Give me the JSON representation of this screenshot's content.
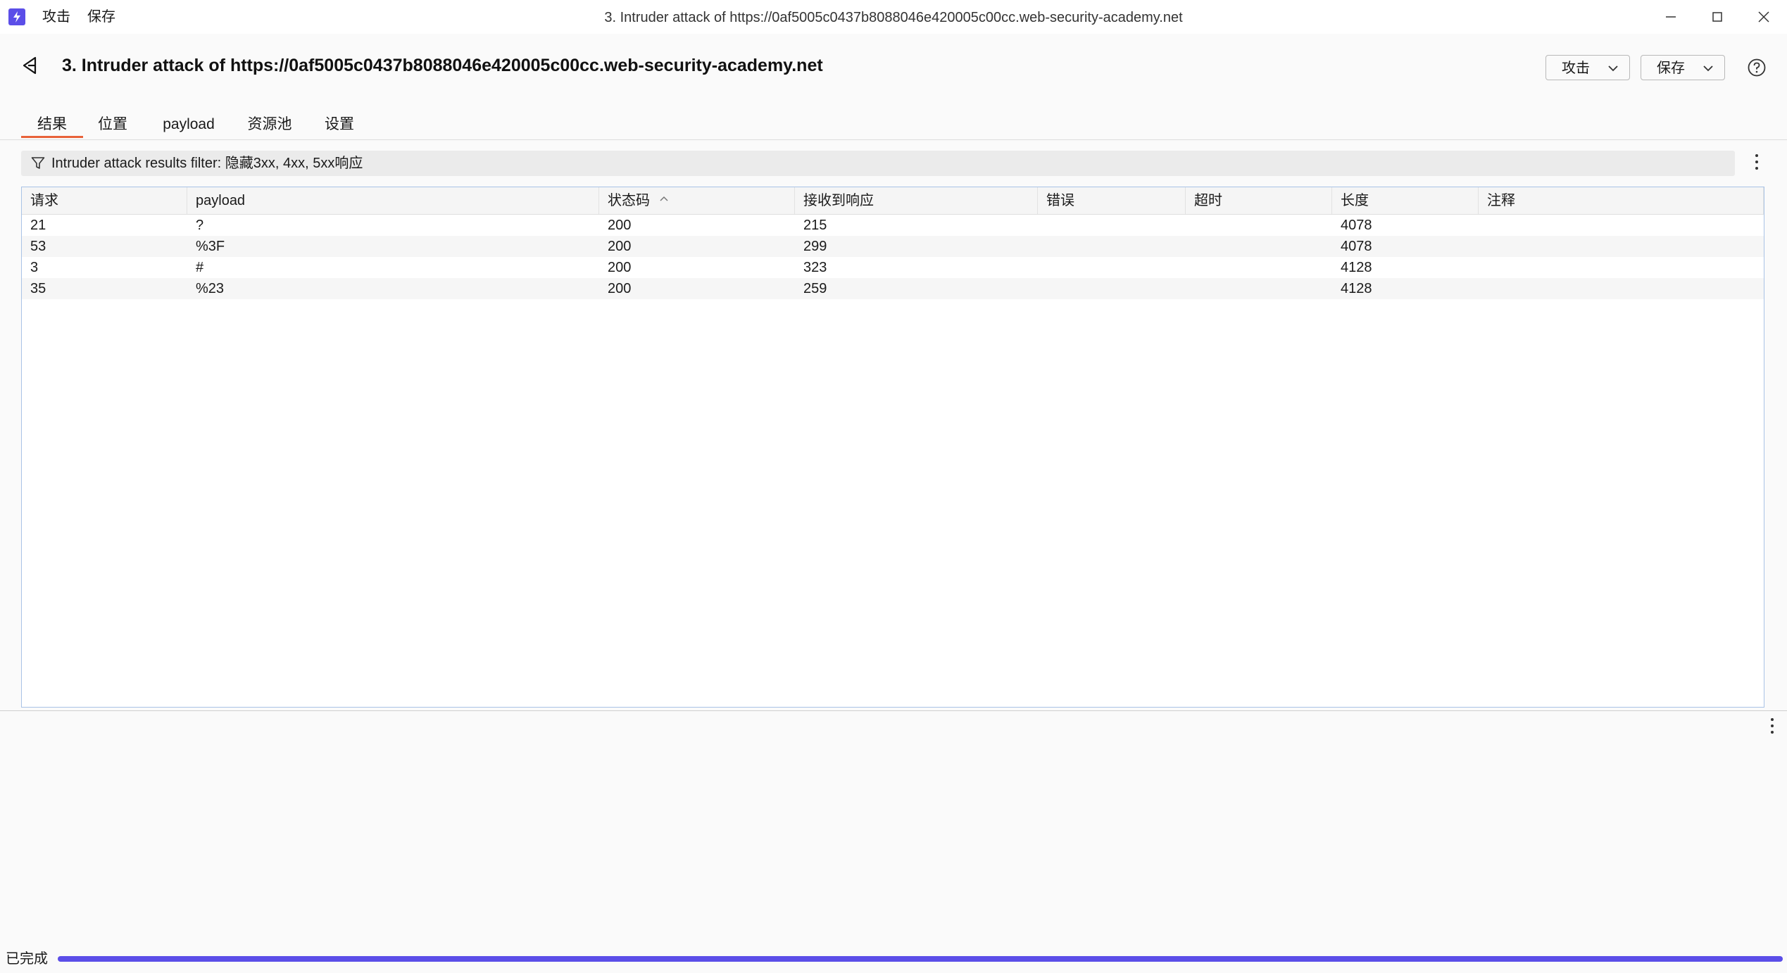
{
  "app": {
    "menu": [
      "攻击",
      "保存"
    ],
    "window_title": "3. Intruder attack of https://0af5005c0437b8088046e420005c00cc.web-security-academy.net"
  },
  "header": {
    "title": "3. Intruder attack of https://0af5005c0437b8088046e420005c00cc.web-security-academy.net",
    "attack_button": "攻击",
    "save_button": "保存"
  },
  "tabs": [
    "结果",
    "位置",
    "payload",
    "资源池",
    "设置"
  ],
  "active_tab": "结果",
  "filter": {
    "text": "Intruder attack results filter: 隐藏3xx, 4xx, 5xx响应"
  },
  "table": {
    "columns": [
      "请求",
      "payload",
      "状态码",
      "接收到响应",
      "错误",
      "超时",
      "长度",
      "注释"
    ],
    "sorted_column": "状态码",
    "sort_direction": "ascending",
    "rows": [
      [
        "21",
        "?",
        "200",
        "215",
        "",
        "",
        "4078",
        ""
      ],
      [
        "53",
        "%3F",
        "200",
        "299",
        "",
        "",
        "4078",
        ""
      ],
      [
        "3",
        "#",
        "200",
        "323",
        "",
        "",
        "4128",
        ""
      ],
      [
        "35",
        "%23",
        "200",
        "259",
        "",
        "",
        "4128",
        ""
      ]
    ]
  },
  "status": {
    "text": "已完成",
    "progress": 1.0
  },
  "colors": {
    "accent": "#5b4ee8",
    "tab_underline": "#e8623a",
    "table_border": "#a9c3e6"
  }
}
